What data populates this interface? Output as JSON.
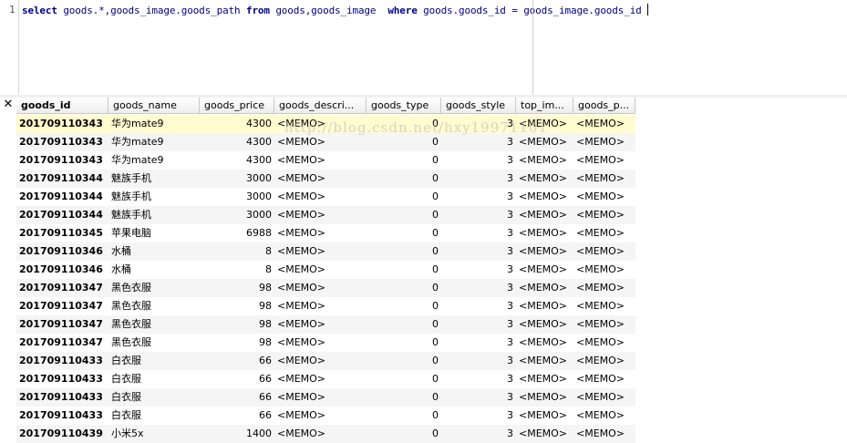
{
  "editor": {
    "line_number": "1",
    "tokens": [
      {
        "t": "select",
        "kw": true
      },
      {
        "t": " goods.*,goods_image.goods_path ",
        "kw": false
      },
      {
        "t": "from",
        "kw": true
      },
      {
        "t": " goods,goods_image  ",
        "kw": false
      },
      {
        "t": "where",
        "kw": true
      },
      {
        "t": " goods.goods_id = goods_image.goods_id",
        "kw": false
      }
    ]
  },
  "grid": {
    "corner_label": "✕",
    "columns": [
      "goods_id",
      "goods_name",
      "goods_price",
      "goods_descri...",
      "goods_type",
      "goods_style",
      "top_im...",
      "goods_p..."
    ],
    "rows": [
      [
        "201709110343",
        "华为mate9",
        "4300",
        "<MEMO>",
        "0",
        "3",
        "<MEMO>",
        "<MEMO>"
      ],
      [
        "201709110343",
        "华为mate9",
        "4300",
        "<MEMO>",
        "0",
        "3",
        "<MEMO>",
        "<MEMO>"
      ],
      [
        "201709110343",
        "华为mate9",
        "4300",
        "<MEMO>",
        "0",
        "3",
        "<MEMO>",
        "<MEMO>"
      ],
      [
        "201709110344",
        "魅族手机",
        "3000",
        "<MEMO>",
        "0",
        "3",
        "<MEMO>",
        "<MEMO>"
      ],
      [
        "201709110344",
        "魅族手机",
        "3000",
        "<MEMO>",
        "0",
        "3",
        "<MEMO>",
        "<MEMO>"
      ],
      [
        "201709110344",
        "魅族手机",
        "3000",
        "<MEMO>",
        "0",
        "3",
        "<MEMO>",
        "<MEMO>"
      ],
      [
        "201709110345",
        "苹果电脑",
        "6988",
        "<MEMO>",
        "0",
        "3",
        "<MEMO>",
        "<MEMO>"
      ],
      [
        "201709110346",
        "水桶",
        "8",
        "<MEMO>",
        "0",
        "3",
        "<MEMO>",
        "<MEMO>"
      ],
      [
        "201709110346",
        "水桶",
        "8",
        "<MEMO>",
        "0",
        "3",
        "<MEMO>",
        "<MEMO>"
      ],
      [
        "201709110347",
        "黑色衣服",
        "98",
        "<MEMO>",
        "0",
        "3",
        "<MEMO>",
        "<MEMO>"
      ],
      [
        "201709110347",
        "黑色衣服",
        "98",
        "<MEMO>",
        "0",
        "3",
        "<MEMO>",
        "<MEMO>"
      ],
      [
        "201709110347",
        "黑色衣服",
        "98",
        "<MEMO>",
        "0",
        "3",
        "<MEMO>",
        "<MEMO>"
      ],
      [
        "201709110347",
        "黑色衣服",
        "98",
        "<MEMO>",
        "0",
        "3",
        "<MEMO>",
        "<MEMO>"
      ],
      [
        "201709110433",
        "白衣服",
        "66",
        "<MEMO>",
        "0",
        "3",
        "<MEMO>",
        "<MEMO>"
      ],
      [
        "201709110433",
        "白衣服",
        "66",
        "<MEMO>",
        "0",
        "3",
        "<MEMO>",
        "<MEMO>"
      ],
      [
        "201709110433",
        "白衣服",
        "66",
        "<MEMO>",
        "0",
        "3",
        "<MEMO>",
        "<MEMO>"
      ],
      [
        "201709110433",
        "白衣服",
        "66",
        "<MEMO>",
        "0",
        "3",
        "<MEMO>",
        "<MEMO>"
      ],
      [
        "201709110439",
        "小米5x",
        "1400",
        "<MEMO>",
        "0",
        "3",
        "<MEMO>",
        "<MEMO>"
      ]
    ],
    "active_row": 0,
    "selected_column": 0
  },
  "watermark": "http://blog.csdn.net/hxy19971101"
}
